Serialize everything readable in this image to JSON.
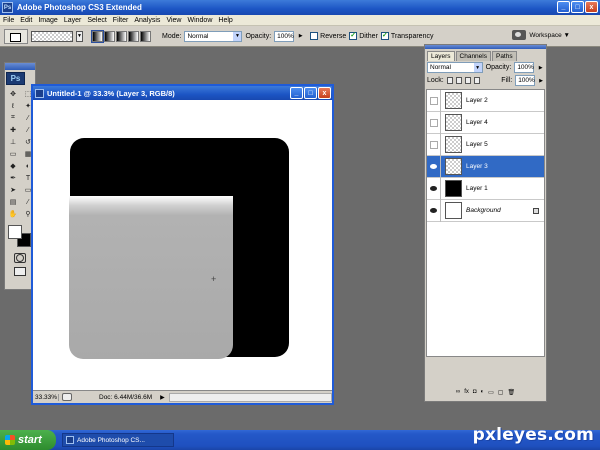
{
  "app": {
    "title": "Adobe Photoshop CS3 Extended",
    "icon_label": "Ps",
    "window_buttons": [
      "_",
      "□",
      "x"
    ]
  },
  "menubar": {
    "items": [
      "File",
      "Edit",
      "Image",
      "Layer",
      "Select",
      "Filter",
      "Analysis",
      "View",
      "Window",
      "Help"
    ]
  },
  "options": {
    "mode_label": "Mode:",
    "mode_value": "Normal",
    "opacity_label": "Opacity:",
    "opacity_value": "100%",
    "reverse_label": "Reverse",
    "reverse_checked": false,
    "dither_label": "Dither",
    "dither_checked": true,
    "transparency_label": "Transparency",
    "transparency_checked": true,
    "workspace_label": "Workspace ▼"
  },
  "tools": {
    "badge": "Ps",
    "icons": [
      "move-icon",
      "marquee-icon",
      "lasso-icon",
      "magic-wand-icon",
      "crop-icon",
      "eyedropper-icon",
      "healing-brush-icon",
      "brush-icon",
      "clone-stamp-icon",
      "history-brush-icon",
      "eraser-icon",
      "gradient-icon",
      "blur-icon",
      "dodge-icon",
      "pen-icon",
      "type-icon",
      "path-selection-icon",
      "shape-icon",
      "notes-icon",
      "eyedropper-sample-icon",
      "hand-icon",
      "zoom-icon"
    ],
    "glyphs": [
      "✥",
      "⬚",
      "ℓ",
      "✦",
      "⌗",
      "⁄",
      "✚",
      "⁄",
      "⊥",
      "↺",
      "▭",
      "▦",
      "◆",
      "◐",
      "✒",
      "T",
      "➤",
      "▭",
      "▤",
      "⁄",
      "✋",
      "⚲"
    ],
    "foreground_color": "#ffffff",
    "background_color": "#000000"
  },
  "document": {
    "title": "Untitled-1 @ 33.3% (Layer 3, RGB/8)",
    "zoom": "33.33%",
    "doc_info": "Doc: 6.44M/36.6M",
    "canvas_colors": {
      "black_shape": "#000000",
      "gray_shape": "#a9a9a9",
      "canvas_bg": "#ffffff"
    }
  },
  "layers_panel": {
    "tabs": [
      "Layers",
      "Channels",
      "Paths"
    ],
    "active_tab": "Layers",
    "blend_mode": "Normal",
    "opacity_label": "Opacity:",
    "opacity_value": "100%",
    "lock_label": "Lock:",
    "fill_label": "Fill:",
    "fill_value": "100%",
    "layers": [
      {
        "name": "Layer 2",
        "visible": false,
        "selected": false,
        "thumb": "checker"
      },
      {
        "name": "Layer 4",
        "visible": false,
        "selected": false,
        "thumb": "checker"
      },
      {
        "name": "Layer 5",
        "visible": false,
        "selected": false,
        "thumb": "checker"
      },
      {
        "name": "Layer 3",
        "visible": true,
        "selected": true,
        "thumb": "checker"
      },
      {
        "name": "Layer 1",
        "visible": true,
        "selected": false,
        "thumb": "black"
      },
      {
        "name": "Background",
        "visible": true,
        "selected": false,
        "thumb": "white",
        "locked": true
      }
    ],
    "footer_icons": [
      "link-layers-icon",
      "fx-icon",
      "mask-icon",
      "adjustment-icon",
      "group-icon",
      "new-layer-icon",
      "trash-icon"
    ],
    "footer_glyphs": [
      "∞",
      "fx",
      "◘",
      "◐",
      "▭",
      "▢",
      "🗑"
    ]
  },
  "taskbar": {
    "start_label": "start",
    "task_label": "Adobe Photoshop CS..."
  },
  "watermark": {
    "text": "pxleyes.com"
  }
}
